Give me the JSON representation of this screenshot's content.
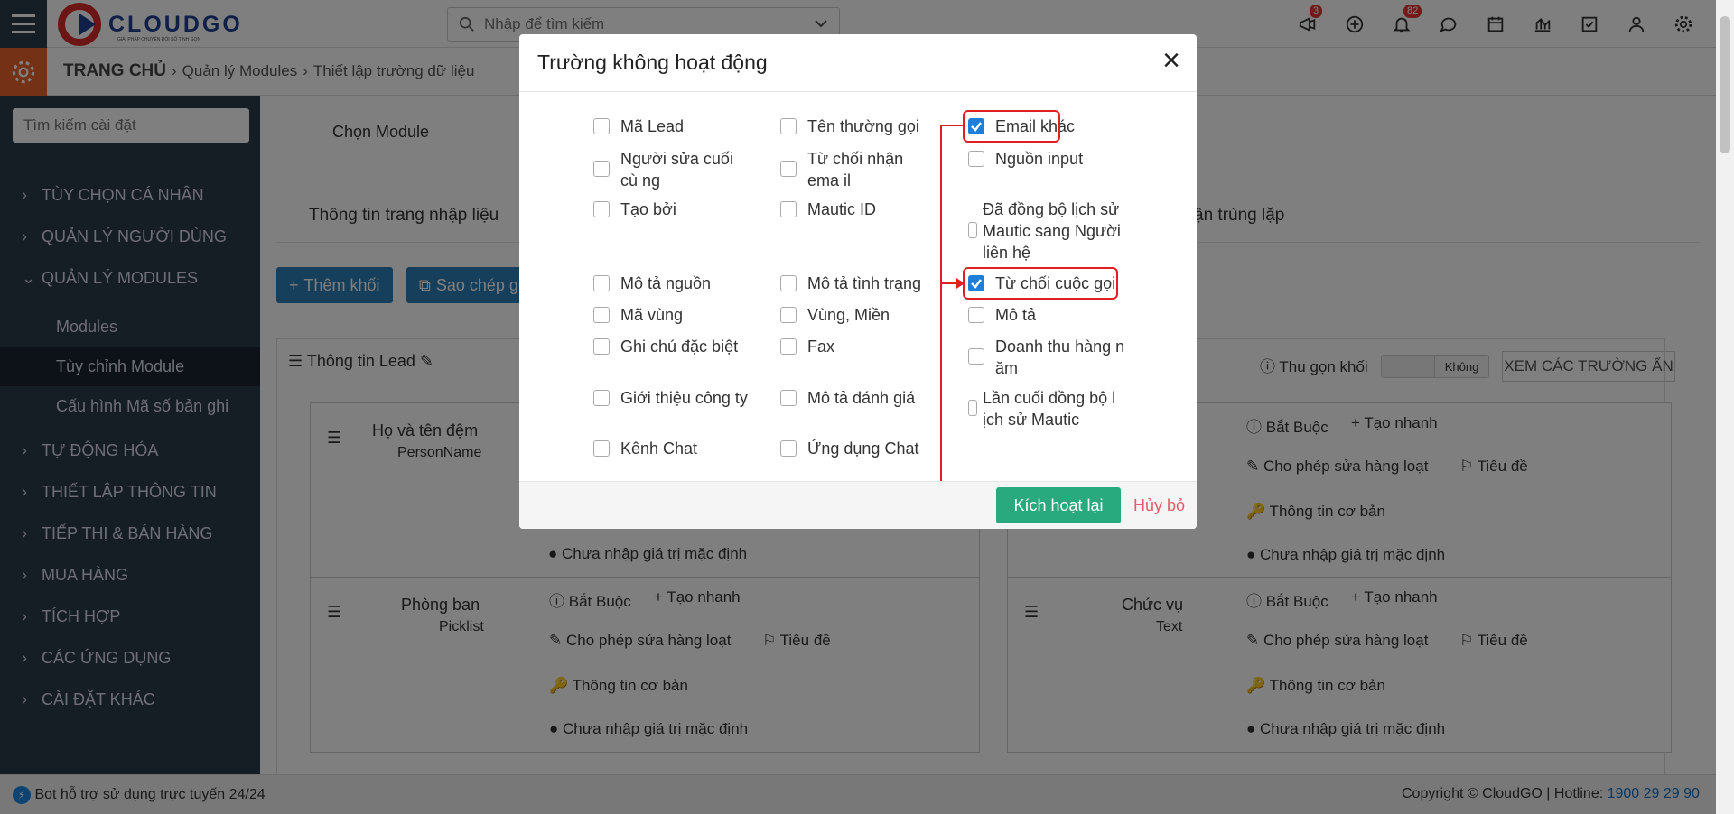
{
  "header": {
    "logo_text": "CLOUDGO",
    "logo_sub": "GIẢI PHÁP CHUYỂN ĐỔI SỐ TINH GỌN",
    "search_placeholder": "Nhập để tìm kiếm",
    "badge_announce": "3",
    "badge_notify": "82"
  },
  "breadcrumb": {
    "home": "TRANG CHỦ",
    "level1": "Quản lý Modules",
    "level2": "Thiết lập trường dữ liệu"
  },
  "sidebar": {
    "search_placeholder": "Tìm kiếm cài đặt",
    "items": [
      "TÙY CHỌN CÁ NHÂN",
      "QUẢN LÝ NGƯỜI DÙNG",
      "QUẢN LÝ MODULES",
      "TỰ ĐỘNG HÓA",
      "THIẾT LẬP THÔNG TIN",
      "TIẾP THỊ & BÁN HÀNG",
      "MUA HÀNG",
      "TÍCH HỢP",
      "CÁC ỨNG DỤNG",
      "CÀI ĐẶT KHÁC"
    ],
    "subitems": [
      "Modules",
      "Tùy chỉnh Module",
      "Cấu hình Mã số bản ghi"
    ]
  },
  "main": {
    "choose_module": "Chọn Module",
    "tab_input": "Thông tin trang nhập liệu",
    "tab_dup": "ận trùng lặp",
    "add_block": "Thêm khối",
    "copy": "Sao chép g",
    "block_title": "Thông tin Lead",
    "collapse": "Thu gọn khối",
    "toggle": "Không",
    "show_hidden": "XEM CÁC TRƯỜNG ẨN",
    "f1_name": "Họ và tên đệm",
    "f1_type": "PersonName",
    "f2_name": "Phòng ban",
    "f2_type": "Picklist",
    "f3_name": "Chức vụ",
    "f3_type": "Text",
    "required": "Bắt Buộc",
    "quick": "Tạo nhanh",
    "mass": "Cho phép sửa hàng loạt",
    "heading": "Tiêu đề",
    "basic": "Thông tin cơ bản",
    "default": "Chưa nhập giá trị mặc định"
  },
  "modal": {
    "title": "Trường không hoạt động",
    "close": "×",
    "reactivate": "Kích hoạt lại",
    "cancel": "Hủy bỏ",
    "col1": [
      "Mã Lead",
      "Người sửa cuối cù ng",
      "Tạo bởi",
      "Mô tả nguồn",
      "Mã vùng",
      "Ghi chú đặc biệt",
      "Giới thiệu công ty",
      "Kênh Chat"
    ],
    "col2": [
      "Tên thường gọi",
      "Từ chối nhận ema il",
      "Mautic ID",
      "Mô tả tình trạng",
      "Vùng, Miền",
      "Fax",
      "Mô tả đánh giá",
      "Ứng dụng Chat"
    ],
    "col3": [
      "Email khác",
      "Nguồn input",
      "Đã đồng bộ lịch sử Mautic sang Người liên hệ",
      "Từ chối cuộc gọi",
      "Mô tả",
      "Doanh thu hàng n ăm",
      "Lần cuối đồng bộ l ịch sử Mautic"
    ]
  },
  "footer": {
    "bot": "Bot hỗ trợ sử dụng trực tuyến 24/24",
    "copyright": "Copyright © CloudGO",
    "hotline_label": "Hotline:",
    "hotline": "1900 29 29 90"
  }
}
